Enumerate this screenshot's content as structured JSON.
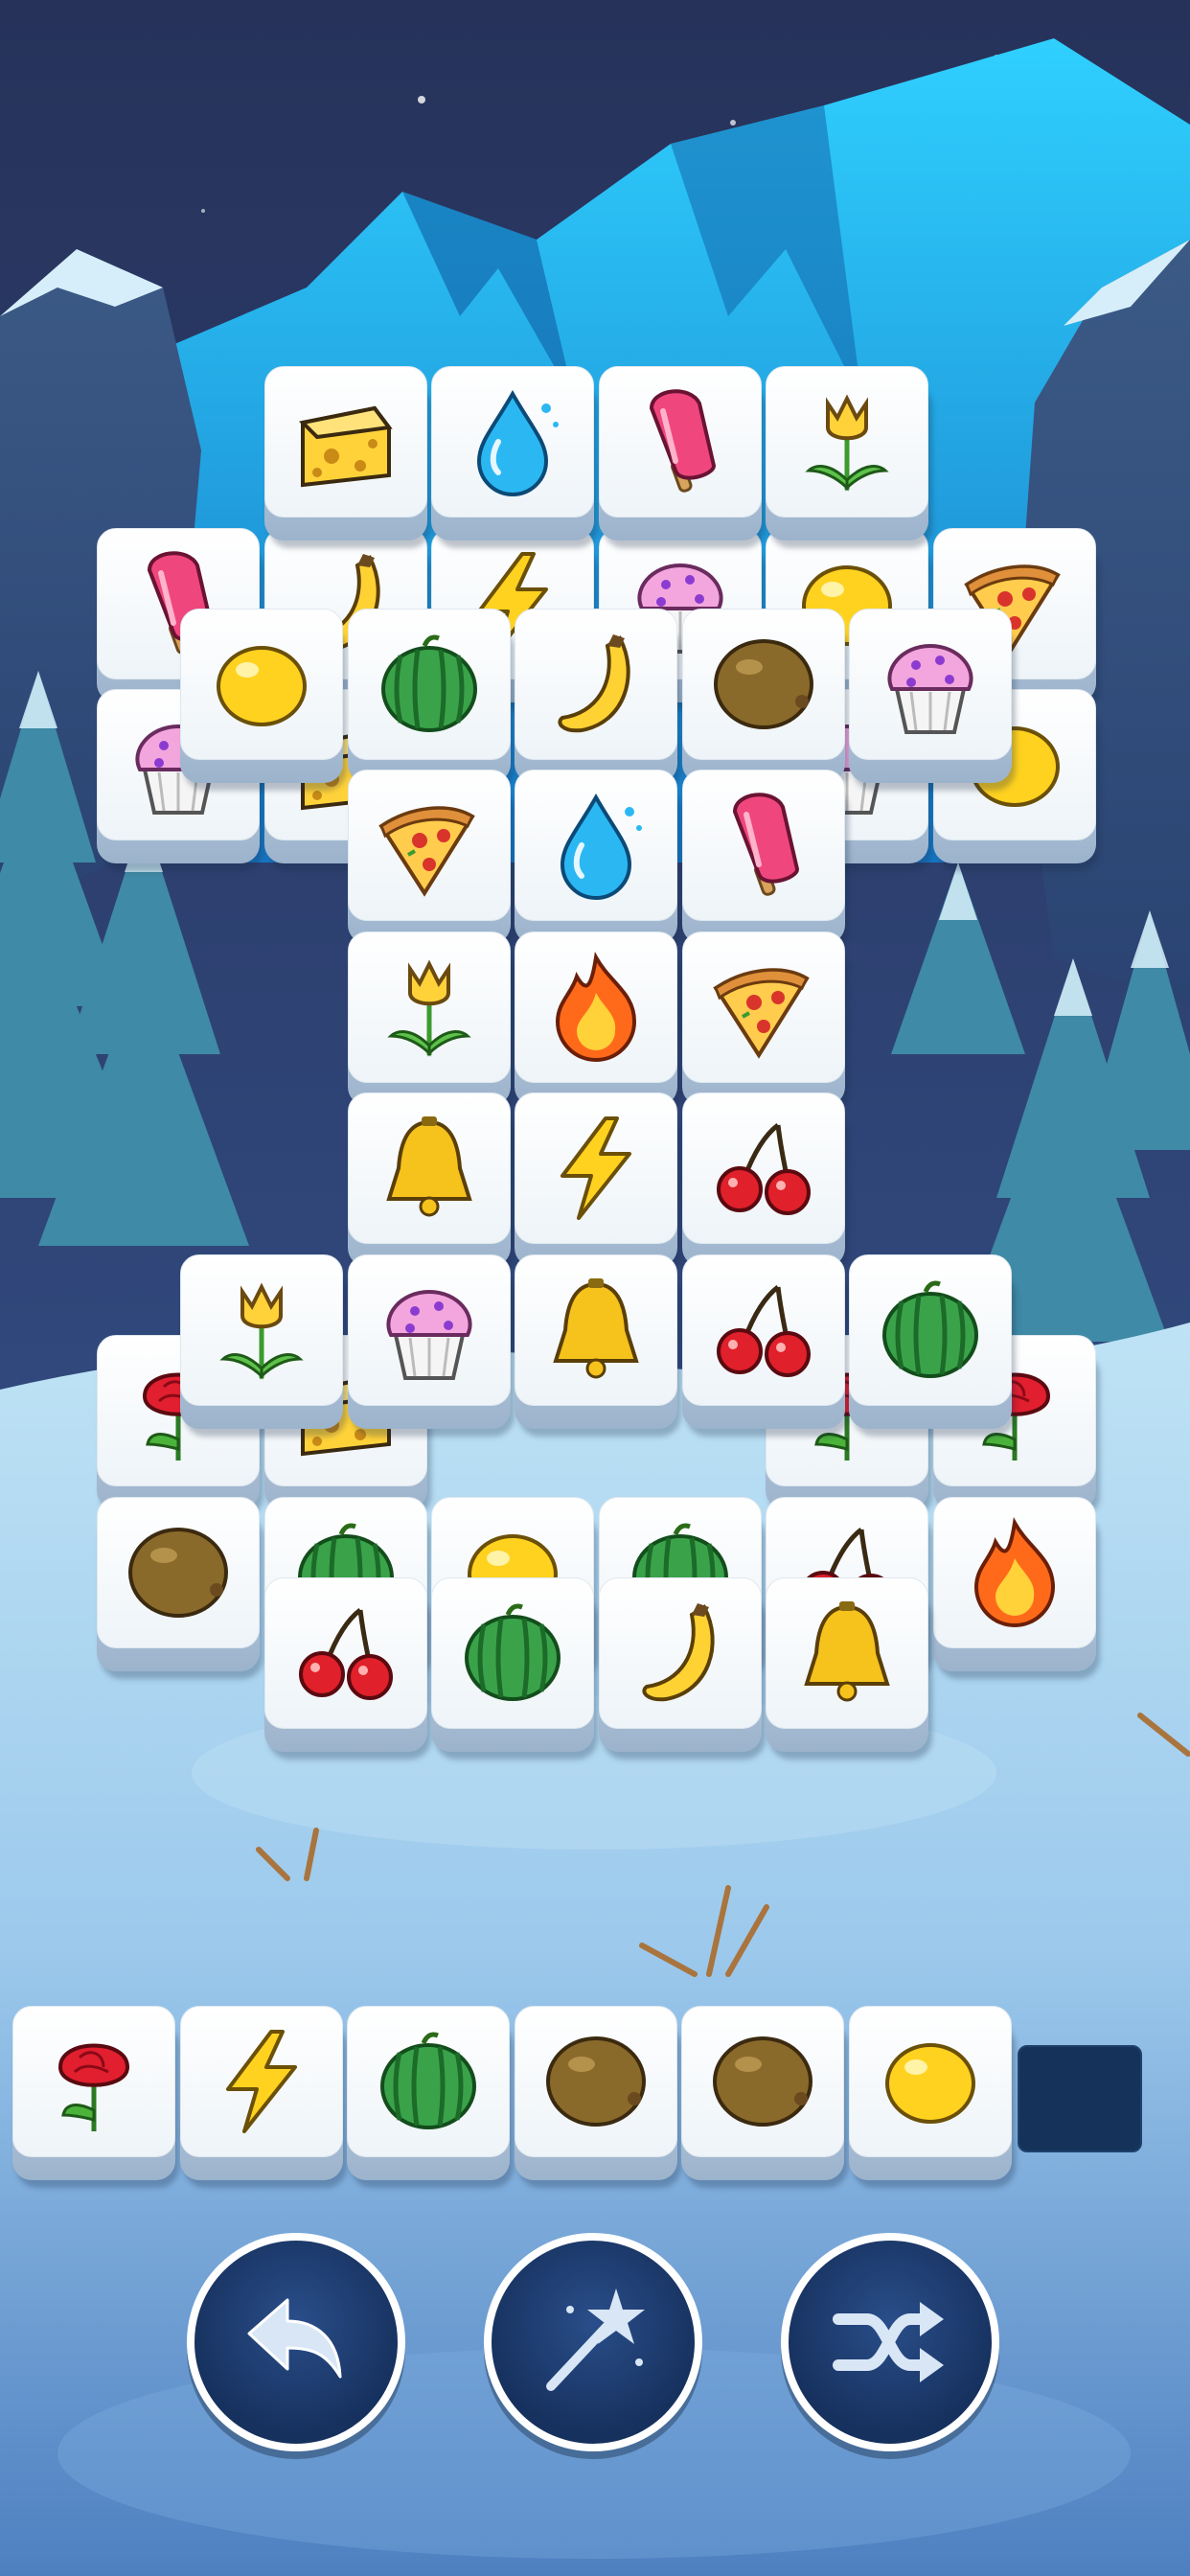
{
  "screen": "tile-match-puzzle",
  "colors": {
    "sky_top": "#26325a",
    "mountain": "#1aa7e6",
    "snow": "#bfe3f5",
    "tray_slot": "#15325a",
    "control_button": "#1f3d70"
  },
  "board": {
    "layers": [
      {
        "name": "bottom",
        "tiles": [
          {
            "row": 1,
            "col": 0,
            "icon": "popsicle-icon"
          },
          {
            "row": 1,
            "col": 1,
            "icon": "banana-icon"
          },
          {
            "row": 1,
            "col": 2,
            "icon": "lightning-icon"
          },
          {
            "row": 1,
            "col": 3,
            "icon": "cupcake-icon"
          },
          {
            "row": 1,
            "col": 4,
            "icon": "lemon-icon"
          },
          {
            "row": 1,
            "col": 5,
            "icon": "pizza-icon"
          },
          {
            "row": 2,
            "col": 0,
            "icon": "cupcake-icon"
          },
          {
            "row": 2,
            "col": 1,
            "icon": "cheese-icon"
          },
          {
            "row": 2,
            "col": 4,
            "icon": "cupcake-icon"
          },
          {
            "row": 2,
            "col": 5,
            "icon": "lemon-icon"
          },
          {
            "row": 6,
            "col": 0,
            "icon": "rose-icon"
          },
          {
            "row": 6,
            "col": 1,
            "icon": "cheese-icon"
          },
          {
            "row": 6,
            "col": 4,
            "icon": "rose-icon"
          },
          {
            "row": 6,
            "col": 5,
            "icon": "rose-icon"
          },
          {
            "row": 7,
            "col": 0,
            "icon": "kiwi-icon"
          },
          {
            "row": 7,
            "col": 1,
            "icon": "watermelon-icon"
          },
          {
            "row": 7,
            "col": 2,
            "icon": "lemon-icon"
          },
          {
            "row": 7,
            "col": 3,
            "icon": "watermelon-icon"
          },
          {
            "row": 7,
            "col": 4,
            "icon": "cherries-icon"
          },
          {
            "row": 7,
            "col": 5,
            "icon": "fire-icon"
          }
        ]
      },
      {
        "name": "top",
        "tiles": [
          {
            "row": 0,
            "col": 1,
            "icon": "cheese-icon"
          },
          {
            "row": 0,
            "col": 2,
            "icon": "water-drop-icon"
          },
          {
            "row": 0,
            "col": 3,
            "icon": "popsicle-icon"
          },
          {
            "row": 0,
            "col": 4,
            "icon": "tulip-icon"
          },
          {
            "row": 1.5,
            "col": 0.5,
            "icon": "lemon-icon"
          },
          {
            "row": 1.5,
            "col": 1.5,
            "icon": "watermelon-icon"
          },
          {
            "row": 1.5,
            "col": 2.5,
            "icon": "banana-icon"
          },
          {
            "row": 1.5,
            "col": 3.5,
            "icon": "kiwi-icon"
          },
          {
            "row": 1.5,
            "col": 4.5,
            "icon": "cupcake-icon"
          },
          {
            "row": 2.5,
            "col": 1.5,
            "icon": "pizza-icon"
          },
          {
            "row": 2.5,
            "col": 2.5,
            "icon": "water-drop-icon"
          },
          {
            "row": 2.5,
            "col": 3.5,
            "icon": "popsicle-icon"
          },
          {
            "row": 3.5,
            "col": 1.5,
            "icon": "tulip-icon"
          },
          {
            "row": 3.5,
            "col": 2.5,
            "icon": "fire-icon"
          },
          {
            "row": 3.5,
            "col": 3.5,
            "icon": "pizza-icon"
          },
          {
            "row": 4.5,
            "col": 1.5,
            "icon": "bell-icon"
          },
          {
            "row": 4.5,
            "col": 2.5,
            "icon": "lightning-icon"
          },
          {
            "row": 4.5,
            "col": 3.5,
            "icon": "cherries-icon"
          },
          {
            "row": 5.5,
            "col": 0.5,
            "icon": "tulip-icon"
          },
          {
            "row": 5.5,
            "col": 1.5,
            "icon": "cupcake-icon"
          },
          {
            "row": 5.5,
            "col": 2.5,
            "icon": "bell-icon"
          },
          {
            "row": 5.5,
            "col": 3.5,
            "icon": "cherries-icon"
          },
          {
            "row": 5.5,
            "col": 4.5,
            "icon": "watermelon-icon"
          },
          {
            "row": 7.5,
            "col": 1,
            "icon": "cherries-icon"
          },
          {
            "row": 7.5,
            "col": 2,
            "icon": "watermelon-icon"
          },
          {
            "row": 7.5,
            "col": 3,
            "icon": "banana-icon"
          },
          {
            "row": 7.5,
            "col": 4,
            "icon": "bell-icon"
          }
        ]
      }
    ]
  },
  "tray": {
    "capacity": 7,
    "tiles": [
      "rose-icon",
      "lightning-icon",
      "watermelon-icon",
      "kiwi-icon",
      "kiwi-icon",
      "lemon-icon"
    ]
  },
  "controls": [
    {
      "name": "undo-button",
      "icon": "undo-arrow-icon"
    },
    {
      "name": "hint-button",
      "icon": "magic-wand-icon"
    },
    {
      "name": "shuffle-button",
      "icon": "shuffle-icon"
    }
  ]
}
